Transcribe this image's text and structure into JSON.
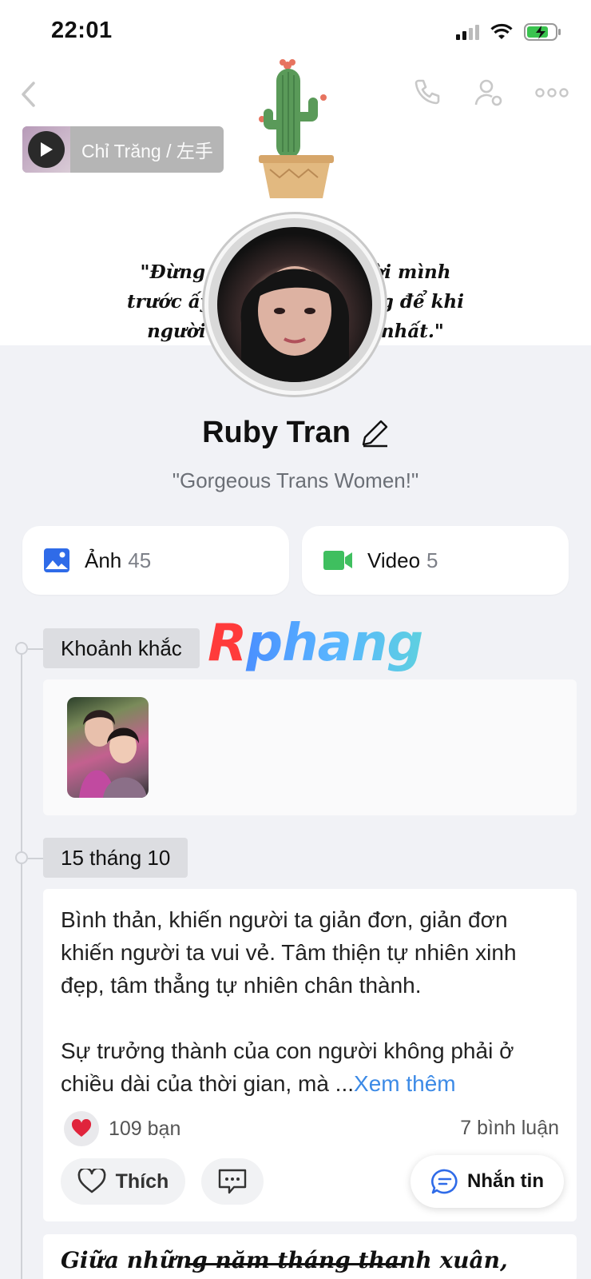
{
  "status_bar": {
    "time": "22:01"
  },
  "music": {
    "title": "Chỉ Trăng / 左手"
  },
  "cover": {
    "quote_lines": [
      "\"Đừng vội tìm con người mình",
      "trước ấy, yêu lấy nó. Đừng để khi",
      "người đó xuất mình tệ nhất.\""
    ]
  },
  "profile": {
    "name": "Ruby Tran",
    "bio": "\"Gorgeous Trans Women!\""
  },
  "media": {
    "photos": {
      "label": "Ảnh",
      "count": "45"
    },
    "videos": {
      "label": "Video",
      "count": "5"
    }
  },
  "watermark": "Rphang",
  "timeline": {
    "moments_label": "Khoảnh khắc",
    "date_label": "15 tháng 10"
  },
  "post": {
    "paragraph1": "Bình thản, khiến người ta giản đơn, giản đơn khiến người ta vui vẻ. Tâm thiện tự nhiên xinh đẹp, tâm thẳng tự nhiên chân thành.",
    "paragraph2": "Sự trưởng thành của con người không phải ở chiều dài của thời gian, mà ...",
    "see_more": "Xem thêm",
    "reactions": "109 bạn",
    "comments": "7 bình luận",
    "like_label": "Thích",
    "message_label": "Nhắn tin"
  },
  "next_post_preview": "Giữa những năm tháng thanh xuân,",
  "colors": {
    "accent_blue": "#3c8ae6",
    "photo_icon": "#2f6be8",
    "video_icon": "#3fbf5f",
    "heart": "#e0243c"
  }
}
